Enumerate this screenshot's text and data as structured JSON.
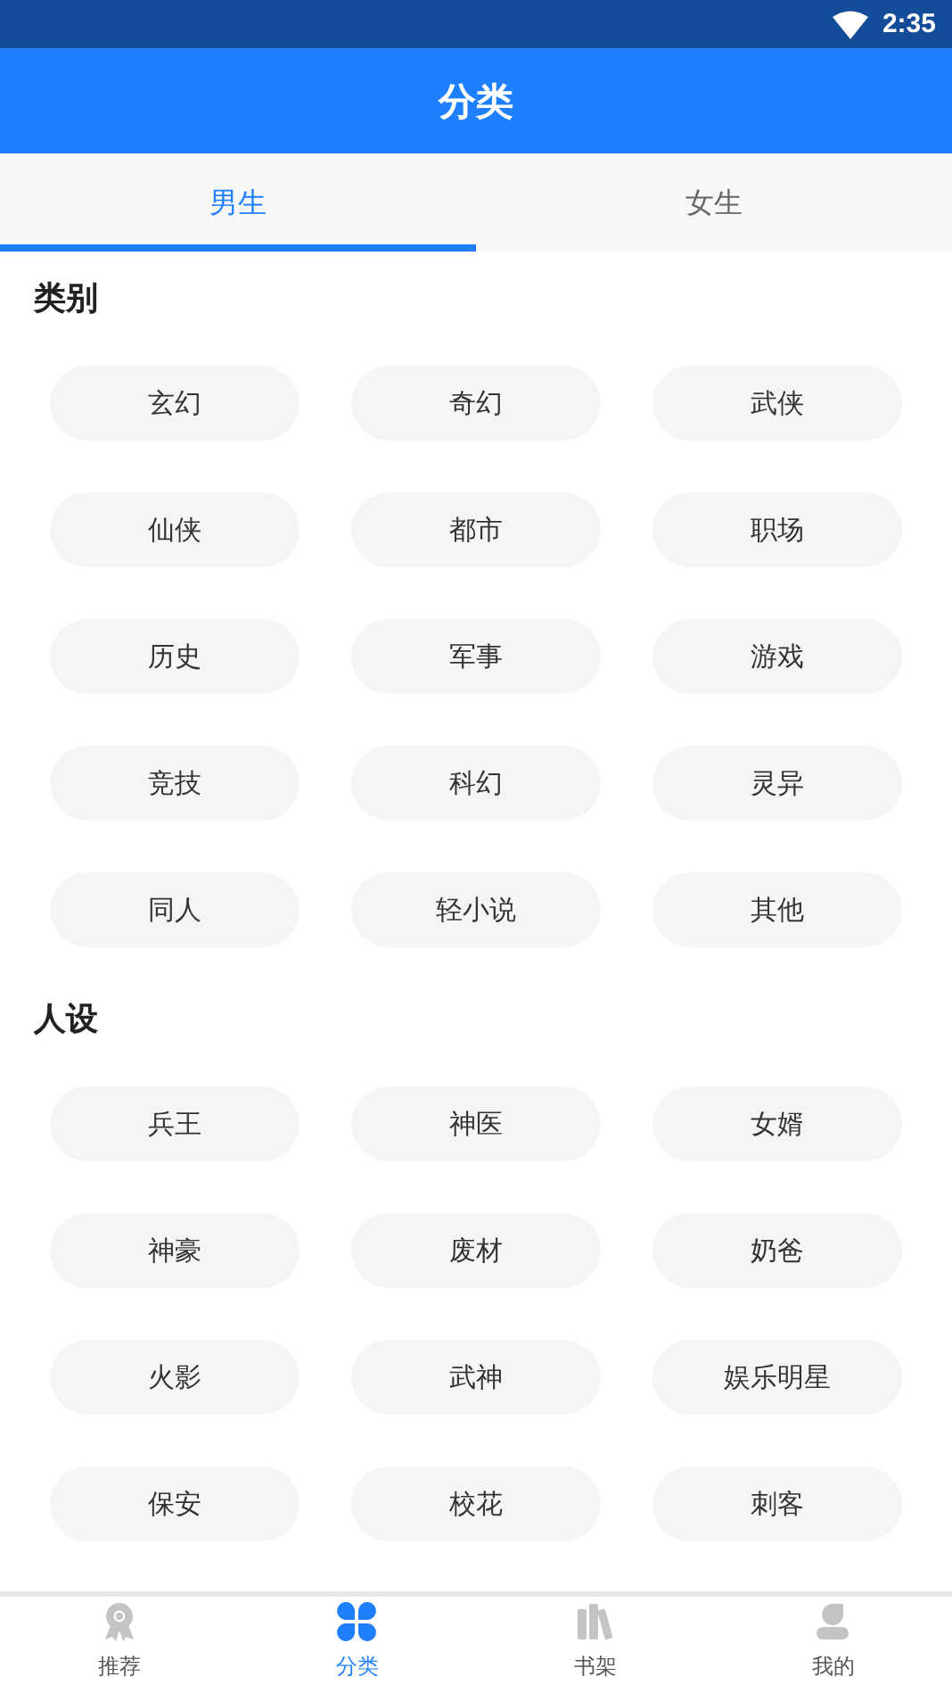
{
  "status_bar": {
    "time": "2:35"
  },
  "header": {
    "title": "分类"
  },
  "tabs": [
    {
      "label": "男生",
      "selected": true
    },
    {
      "label": "女生",
      "selected": false
    }
  ],
  "sections": [
    {
      "title": "类别",
      "tags": [
        "玄幻",
        "奇幻",
        "武侠",
        "仙侠",
        "都市",
        "职场",
        "历史",
        "军事",
        "游戏",
        "竞技",
        "科幻",
        "灵异",
        "同人",
        "轻小说",
        "其他"
      ]
    },
    {
      "title": "人设",
      "tags": [
        "兵王",
        "神医",
        "女婿",
        "神豪",
        "废材",
        "奶爸",
        "火影",
        "武神",
        "娱乐明星",
        "保安",
        "校花",
        "刺客"
      ]
    }
  ],
  "bottom_nav": [
    {
      "label": "推荐",
      "kind": "award",
      "selected": false
    },
    {
      "label": "分类",
      "kind": "clover",
      "selected": true
    },
    {
      "label": "书架",
      "kind": "books",
      "selected": false
    },
    {
      "label": "我的",
      "kind": "person",
      "selected": false
    }
  ]
}
